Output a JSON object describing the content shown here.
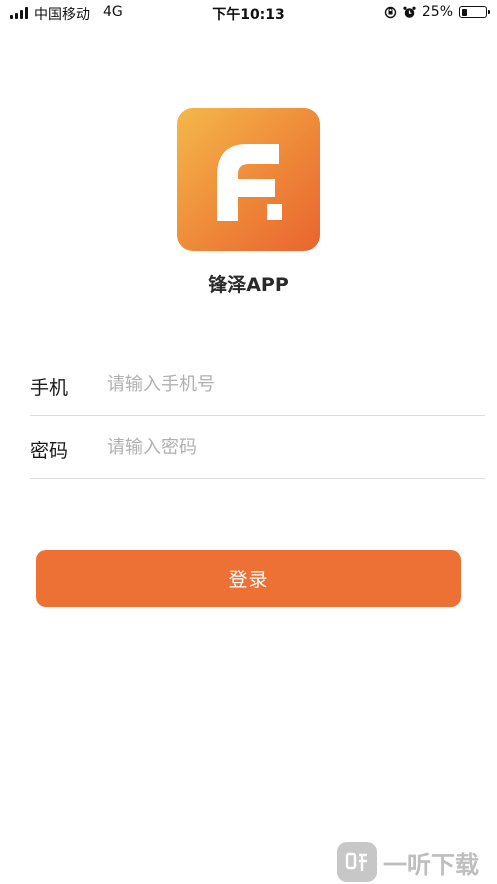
{
  "status_bar": {
    "carrier": "中国移动",
    "network": "4G",
    "time": "下午10:13",
    "battery_percent_text": "25%",
    "battery_level": 0.25
  },
  "app": {
    "name": "锋泽APP",
    "logo_colors": [
      "#f4b84a",
      "#ef8c3a",
      "#e9642f"
    ]
  },
  "form": {
    "phone": {
      "label": "手机",
      "placeholder": "请输入手机号",
      "value": ""
    },
    "password": {
      "label": "密码",
      "placeholder": "请输入密码",
      "value": ""
    },
    "submit_label": "登录",
    "accent_color": "#ed7035"
  },
  "watermark": {
    "text": "一听下载"
  }
}
